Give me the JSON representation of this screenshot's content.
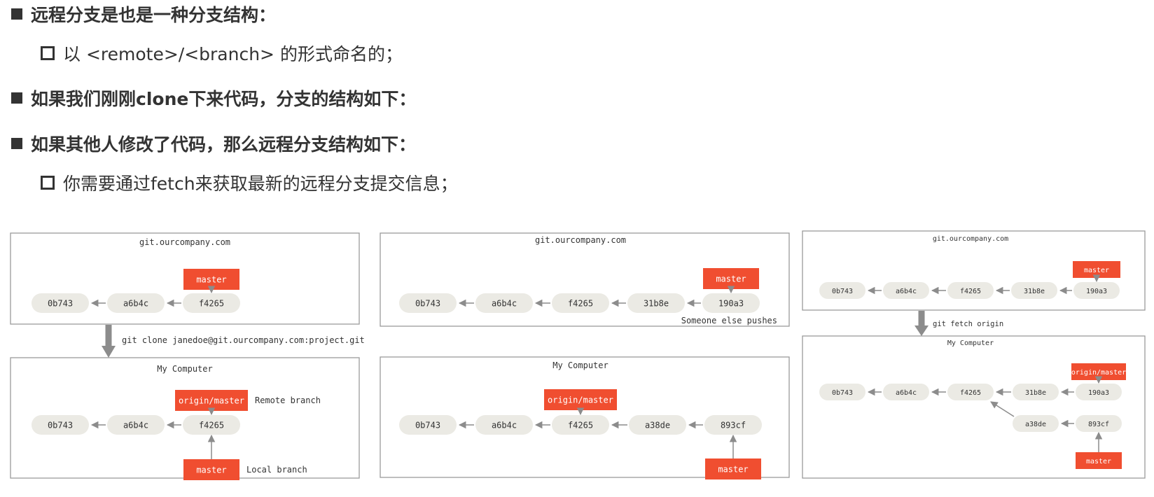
{
  "bullets": [
    "远程分支是也是一种分支结构：",
    "如果我们刚刚clone下来代码，分支的结构如下：",
    "如果其他人修改了代码，那么远程分支结构如下："
  ],
  "subbullets": [
    "以 <remote>/<branch> 的形式命名的；",
    "你需要通过fetch来获取最新的远程分支提交信息；"
  ],
  "colors": {
    "branch": "#f04e30",
    "commit": "#ebeae4",
    "edge": "#8c8c8c",
    "text": "#333333"
  },
  "panels": [
    {
      "id": "p1",
      "server": {
        "title": "git.ourcompany.com",
        "commits": [
          "0b743",
          "a6b4c",
          "f4265"
        ],
        "branches": [
          {
            "label": "master",
            "target": "f4265",
            "pos": "above"
          }
        ],
        "note": ""
      },
      "transfer": "git clone janedoe@git.ourcompany.com:project.git",
      "local": {
        "title": "My Computer",
        "commits": [
          "0b743",
          "a6b4c",
          "f4265"
        ],
        "branches": [
          {
            "label": "origin/master",
            "target": "f4265",
            "pos": "above",
            "caption": "Remote branch"
          },
          {
            "label": "master",
            "target": "f4265",
            "pos": "below",
            "caption": "Local branch"
          }
        ]
      }
    },
    {
      "id": "p2",
      "server": {
        "title": "git.ourcompany.com",
        "commits": [
          "0b743",
          "a6b4c",
          "f4265",
          "31b8e",
          "190a3"
        ],
        "branches": [
          {
            "label": "master",
            "target": "190a3",
            "pos": "above"
          }
        ],
        "note": "Someone else pushes"
      },
      "transfer": "",
      "local": {
        "title": "My Computer",
        "commits": [
          "0b743",
          "a6b4c",
          "f4265",
          "a38de",
          "893cf"
        ],
        "branches": [
          {
            "label": "origin/master",
            "target": "f4265",
            "pos": "above"
          },
          {
            "label": "master",
            "target": "893cf",
            "pos": "below"
          }
        ]
      }
    },
    {
      "id": "p3",
      "server": {
        "title": "git.ourcompany.com",
        "commits": [
          "0b743",
          "a6b4c",
          "f4265",
          "31b8e",
          "190a3"
        ],
        "branches": [
          {
            "label": "master",
            "target": "190a3",
            "pos": "above"
          }
        ],
        "note": ""
      },
      "transfer": "git fetch origin",
      "local": {
        "title": "My Computer",
        "commits": [
          "0b743",
          "a6b4c",
          "f4265",
          "31b8e",
          "190a3"
        ],
        "fork": {
          "commits": [
            "a38de",
            "893cf"
          ],
          "parent": "f4265"
        },
        "branches": [
          {
            "label": "origin/master",
            "target": "190a3",
            "pos": "above"
          },
          {
            "label": "master",
            "target": "893cf",
            "pos": "below"
          }
        ]
      }
    }
  ]
}
